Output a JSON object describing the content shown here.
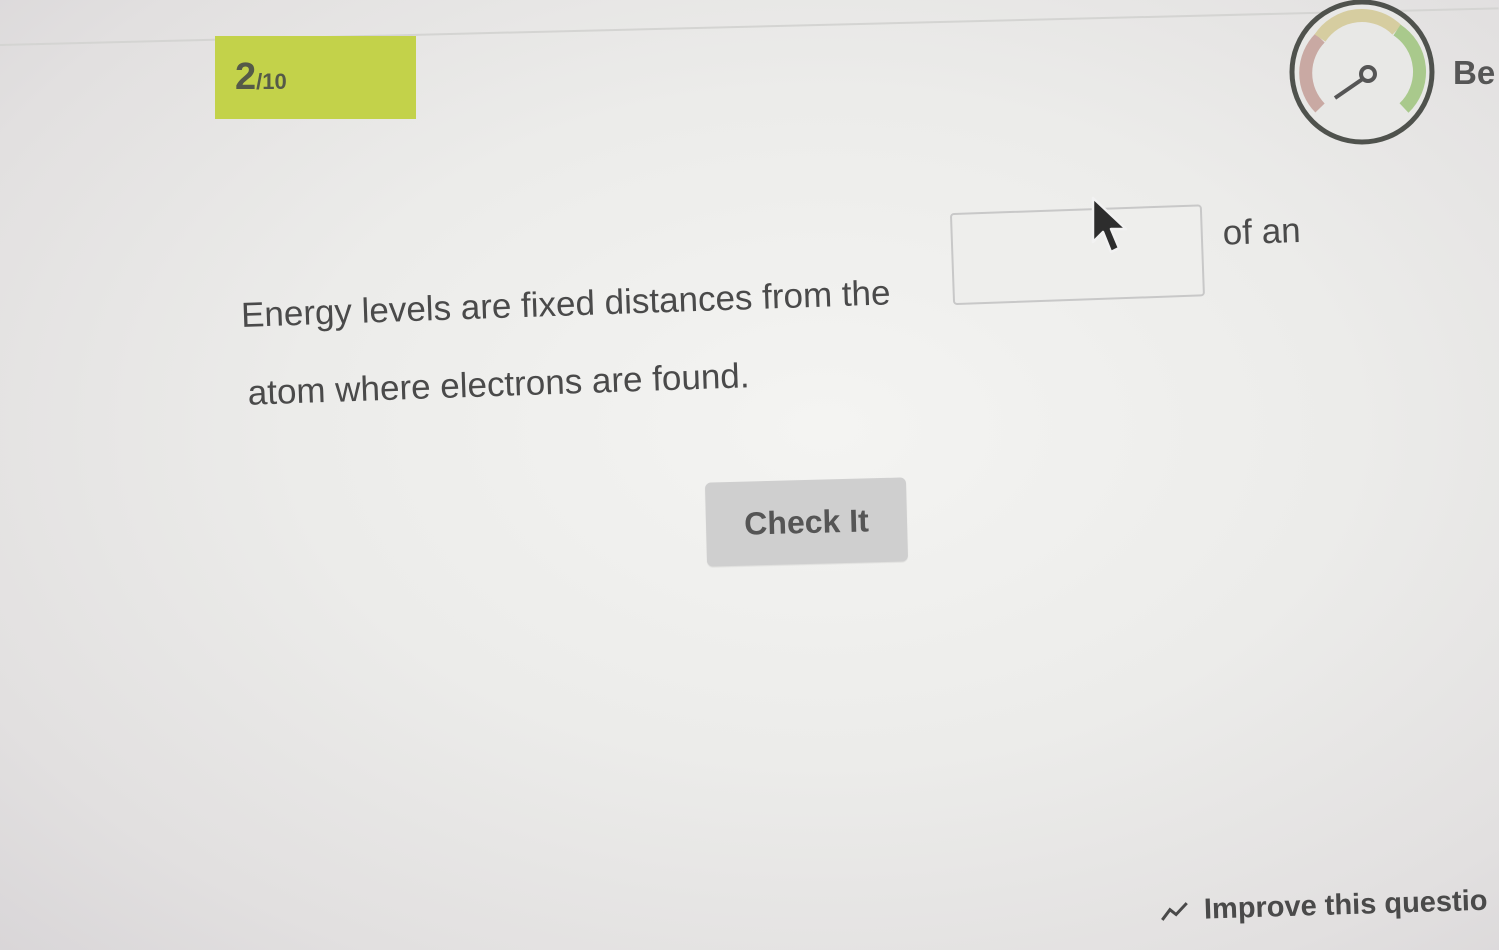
{
  "progress": {
    "current": "2",
    "total": "/10"
  },
  "speedometer": {
    "label": "Be"
  },
  "question": {
    "part1": "Energy levels are fixed distances from the",
    "blank_value": "",
    "part2": "of an",
    "line2": "atom where electrons are found."
  },
  "check_button": {
    "label": "Check It"
  },
  "footer": {
    "improve_label": "Improve this questio"
  },
  "icons": {
    "speedometer": "speedometer-icon",
    "improve": "trend-line-icon",
    "cursor": "mouse-pointer-icon"
  },
  "colors": {
    "progress_badge": "#c3d24a",
    "button": "#cfcfcf",
    "text": "#4a4a4a"
  }
}
